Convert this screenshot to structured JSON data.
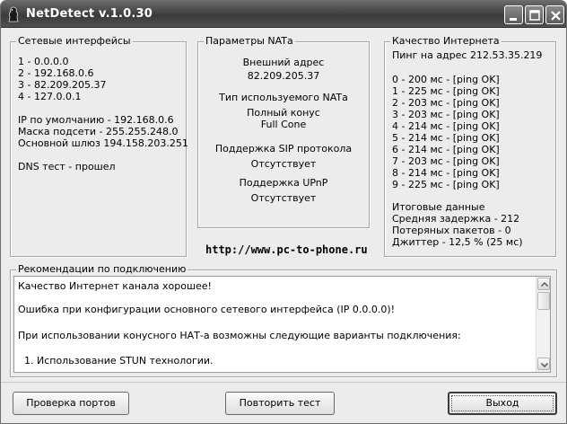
{
  "window": {
    "title": "NetDetect v.1.0.30",
    "icon": "app-icon"
  },
  "interfaces": {
    "title": "Сетевые интерфейсы",
    "items": [
      "1 - 0.0.0.0",
      "2 - 192.168.0.6",
      "3 - 82.209.205.37",
      "4 - 127.0.0.1"
    ],
    "default_ip": "IP по умолчанию - 192.168.0.6",
    "mask": "Маска подсети - 255.255.248.0",
    "gateway": "Основной шлюз 194.158.203.251",
    "dns": "DNS тест - прошел"
  },
  "nat": {
    "title": "Параметры NATа",
    "external_label": "Внешний адрес",
    "external_value": "82.209.205.37",
    "type_label": "Тип используемого NATа",
    "type_value_1": "Полный конус",
    "type_value_2": "Full Cone",
    "sip_label": "Поддержка SIP протокола",
    "sip_value": "Отсутствует",
    "upnp_label": "Поддержка UPnP",
    "upnp_value": "Отсутствует"
  },
  "quality": {
    "title": "Качество Интернета",
    "ping_header": "Пинг на адрес 212.53.35.219",
    "pings": [
      "0 - 200 мс -  [ping OK]",
      "1 - 225 мс -  [ping OK]",
      "2 - 203 мс -  [ping OK]",
      "3 - 203 мс -  [ping OK]",
      "4 - 214 мс -  [ping OK]",
      "5 - 214 мс -  [ping OK]",
      "6 - 214 мс -  [ping OK]",
      "7 - 203 мс -  [ping OK]",
      "8 - 214 мс -  [ping OK]",
      "9 - 225 мс -  [ping OK]"
    ],
    "summary_title": "Итоговые данные",
    "avg": "Средняя задержка - 212",
    "lost": "Потеряных пакетов - 0",
    "jitter": "Джиттер - 12,5 %  (25 мс)"
  },
  "url": "http://www.pc-to-phone.ru",
  "recommendations": {
    "title": "Рекомендации по подключению",
    "lines": [
      "Качество Интернет канала хорошее!",
      "Ошибка при конфигурации основного сетевого интерфейса (IP 0.0.0.0)!",
      "При использовании конусного НАТ-а возможны следующие варианты подключения:",
      "  1. Использование STUN технологии."
    ]
  },
  "buttons": {
    "check_ports": "Проверка портов",
    "retest": "Повторить тест",
    "exit": "Выход"
  }
}
